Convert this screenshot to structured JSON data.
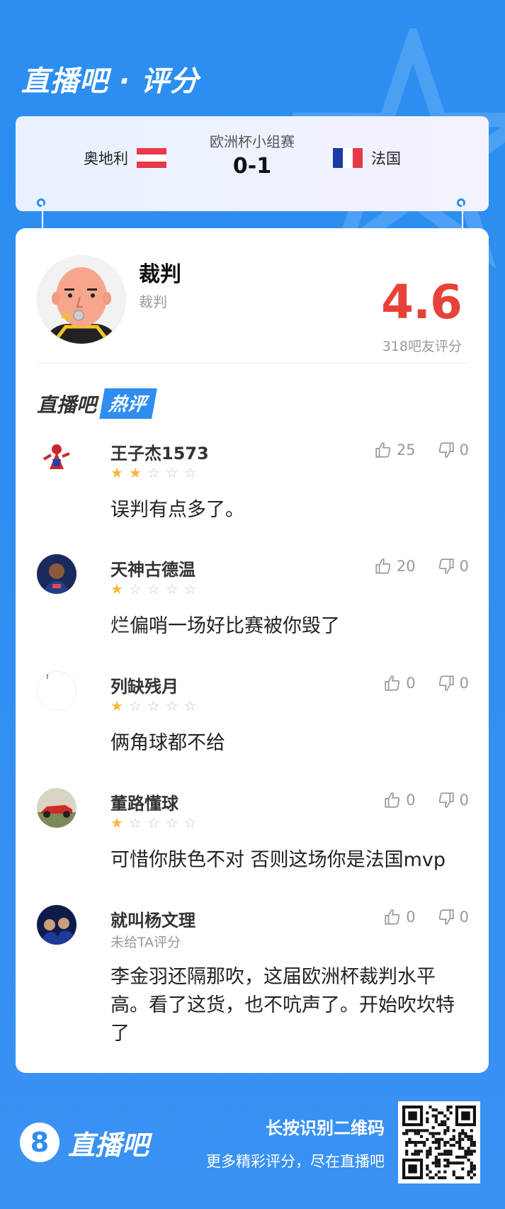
{
  "header": {
    "title": "直播吧 · 评分"
  },
  "match": {
    "home_team": "奥地利",
    "away_team": "法国",
    "competition": "欧洲杯小组赛",
    "score": "0-1"
  },
  "player": {
    "name": "裁判",
    "role": "裁判",
    "rating": "4.6",
    "rating_count": "318吧友评分"
  },
  "hot_section": {
    "brand": "直播吧",
    "tag": "热评"
  },
  "comments": [
    {
      "user": "王子杰1573",
      "stars": 2,
      "likes": "25",
      "dislikes": "0",
      "text": "误判有点多了。"
    },
    {
      "user": "天神古德温",
      "stars": 1,
      "likes": "20",
      "dislikes": "0",
      "text": "烂偏哨一场好比赛被你毁了"
    },
    {
      "user": "列缺残月",
      "stars": 1,
      "likes": "0",
      "dislikes": "0",
      "text": "俩角球都不给"
    },
    {
      "user": "董路懂球",
      "stars": 1,
      "likes": "0",
      "dislikes": "0",
      "text": "可惜你肤色不对 否则这场你是法国mvp"
    },
    {
      "user": "就叫杨文理",
      "stars": 0,
      "unrated": "未给TA评分",
      "likes": "0",
      "dislikes": "0",
      "text": "李金羽还隔那吹，这届欧洲杯裁判水平高。看了这货，也不吭声了。开始吹坎特了"
    }
  ],
  "footer": {
    "logo_mark": "8",
    "logo_text": "直播吧",
    "cta_primary": "长按识别二维码",
    "cta_secondary": "更多精彩评分，尽在直播吧"
  }
}
